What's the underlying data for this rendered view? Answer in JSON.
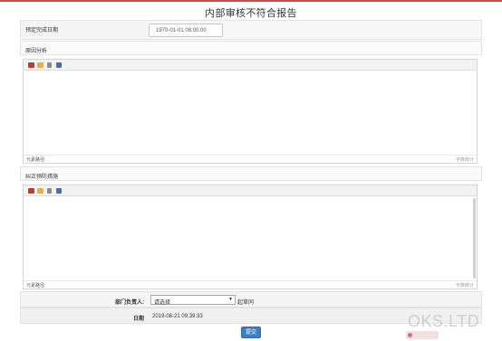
{
  "page": {
    "title": "内部审核不符合报告"
  },
  "planned_completion": {
    "label": "预定完成日期",
    "value": "1970-01-01 08:00:00"
  },
  "cause_analysis": {
    "label": "原因分析",
    "status_path": "元素路径:",
    "word_count": "字数统计"
  },
  "corrective_action": {
    "label": "纠正预防措施",
    "status_path": "元素路径:",
    "word_count": "字数统计"
  },
  "toolbar": {
    "icons": [
      "image-icon",
      "folder-image-icon",
      "attachment-icon",
      "document-icon"
    ]
  },
  "department_head": {
    "label": "部门负责人:",
    "select_value": "请选择",
    "next_link": "起草同"
  },
  "date_field": {
    "label": "日期",
    "value": "2019-08-21 09:39:33"
  },
  "submit": {
    "label": "提交"
  },
  "watermark": {
    "text": "OKS.LTD"
  },
  "colors": {
    "accent": "#c9504a",
    "button": "#3a7fc6"
  }
}
